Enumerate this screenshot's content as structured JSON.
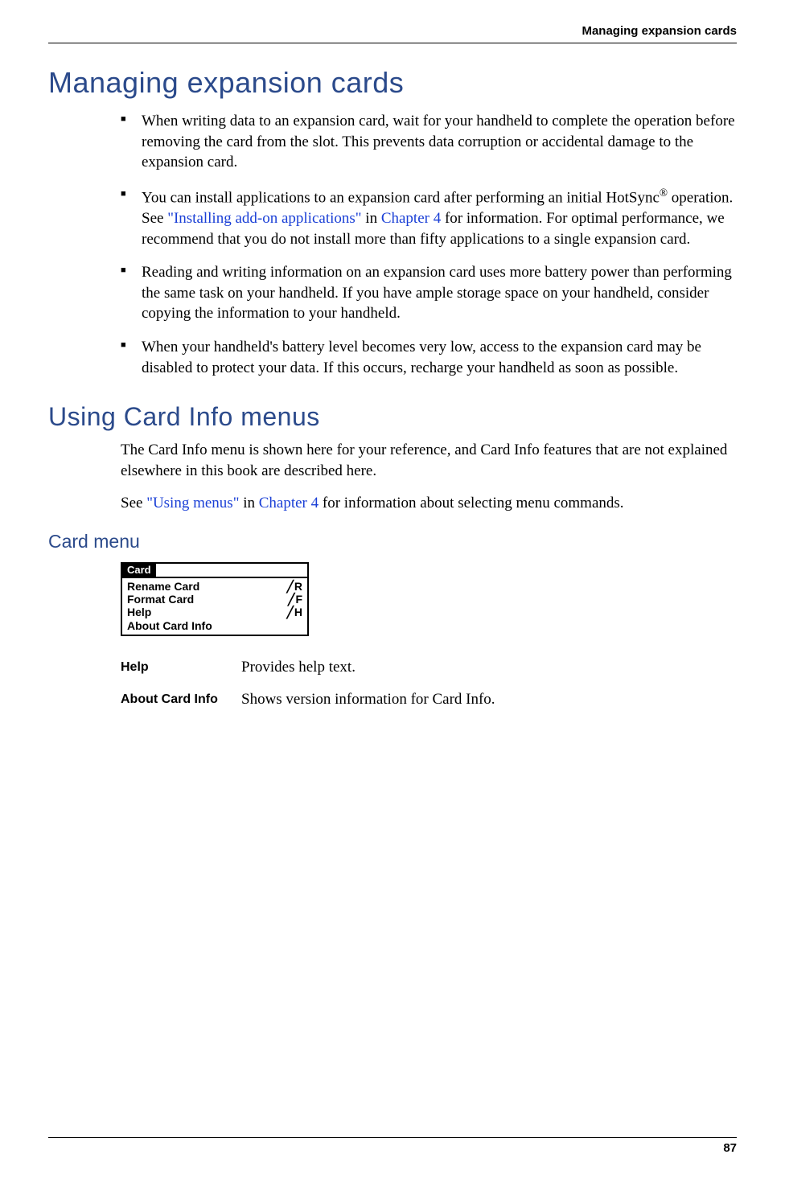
{
  "header": {
    "running_title": "Managing expansion cards"
  },
  "section1": {
    "title": "Managing expansion cards",
    "bullets": [
      {
        "text": "When writing data to an expansion card, wait for your handheld to complete the operation before removing the card from the slot. This prevents data corruption or accidental damage to the expansion card."
      },
      {
        "pre": "You can install applications to an expansion card after performing an initial HotSync",
        "reg": "®",
        "mid1": " operation. See ",
        "link1": "\"Installing add-on applications\"",
        "mid2": " in ",
        "link2": "Chapter 4",
        "post": " for information. For optimal performance, we recommend that you do not install more than fifty applications to a single expansion card."
      },
      {
        "text": "Reading and writing information on an expansion card uses more battery power than performing the same task on your handheld. If you have ample storage space on your handheld, consider copying the information to your handheld."
      },
      {
        "text": "When your handheld's battery level becomes very low, access to the expansion card may be disabled to protect your data. If this occurs, recharge your handheld as soon as possible."
      }
    ]
  },
  "section2": {
    "title": "Using Card Info menus",
    "para1": "The Card Info menu is shown here for your reference, and Card Info features that are not explained elsewhere in this book are described here.",
    "para2_pre": "See ",
    "para2_link1": "\"Using menus\"",
    "para2_mid": " in ",
    "para2_link2": "Chapter 4",
    "para2_post": " for information about selecting menu commands."
  },
  "section3": {
    "title": "Card menu",
    "menu": {
      "tab": "Card",
      "items": [
        {
          "label": "Rename Card",
          "shortcut": "R"
        },
        {
          "label": "Format Card",
          "shortcut": "F"
        },
        {
          "label": "Help",
          "shortcut": "H"
        },
        {
          "label": "About Card Info",
          "shortcut": ""
        }
      ]
    },
    "defs": [
      {
        "term": "Help",
        "desc": "Provides help text."
      },
      {
        "term": "About Card Info",
        "desc": "Shows version information for Card Info."
      }
    ]
  },
  "footer": {
    "page_number": "87"
  }
}
